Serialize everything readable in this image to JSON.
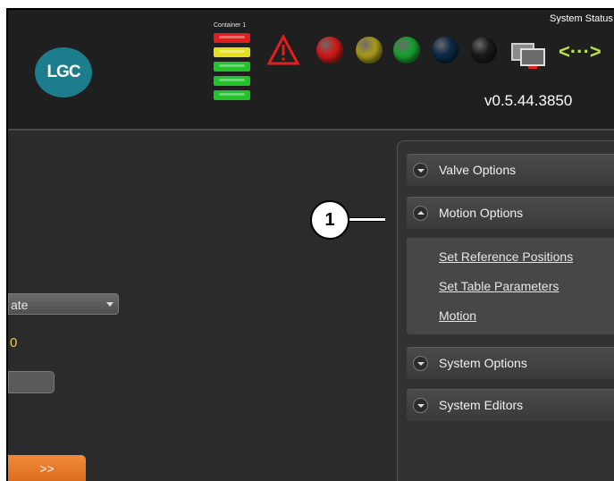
{
  "header": {
    "logo_text": "LGC",
    "container_label": "Container 1",
    "container_levels": [
      "#e11c1c",
      "#e6e01c",
      "#22c22a",
      "#22c22a",
      "#22c22a"
    ],
    "status_lights": [
      "#d01a1a",
      "#a89a1e",
      "#19a030",
      "#0c2a48",
      "#1a1a1a"
    ],
    "system_status": "System Status",
    "version": "v0.5.44.3850",
    "icons": {
      "warning": "warning-triangle-icon",
      "monitor": "monitor-icon",
      "connection": "connection-arrows-icon"
    },
    "connection_glyph": "<···>"
  },
  "left": {
    "select_value": "ate",
    "value_text": "0",
    "next_button": ">>"
  },
  "panel": {
    "sections": [
      {
        "label": "Valve Options",
        "state": "collapsed"
      },
      {
        "label": "Motion Options",
        "state": "expanded"
      },
      {
        "label": "System Options",
        "state": "collapsed"
      },
      {
        "label": "System Editors",
        "state": "collapsed"
      }
    ],
    "motion_links": [
      "Set Reference Positions",
      "Set Table Parameters",
      "Motion"
    ]
  },
  "callout": {
    "number": "1"
  }
}
